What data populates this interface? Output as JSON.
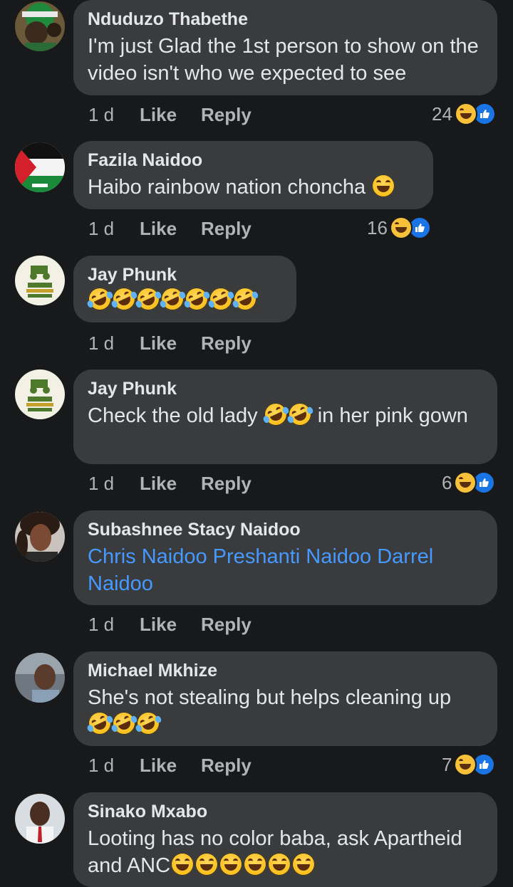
{
  "comments": [
    {
      "author": "Nduduzo Thabethe",
      "text": "I'm just Glad the 1st person to show on the video isn't who we expected to see",
      "age": "1 d",
      "like_label": "Like",
      "reply_label": "Reply",
      "reaction_count": "24",
      "reaction_icons": [
        "haha-icon",
        "like-icon"
      ],
      "avatar": "avatar-photo-green-hat"
    },
    {
      "author": "Fazila Naidoo",
      "text": "Haibo rainbow nation choncha",
      "emoji_count": 1,
      "age": "1 d",
      "like_label": "Like",
      "reply_label": "Reply",
      "reaction_count": "16",
      "reaction_icons": [
        "haha-icon",
        "like-icon"
      ],
      "avatar": "avatar-free-palestine-flag"
    },
    {
      "author": "Jay Phunk",
      "text": "",
      "emoji_count": 7,
      "age": "1 d",
      "like_label": "Like",
      "reply_label": "Reply",
      "avatar": "avatar-support-local-farmers"
    },
    {
      "author": "Jay Phunk",
      "text_before": "Check the old lady",
      "text_after": "in her pink gown",
      "emoji_count": 2,
      "age": "1 d",
      "like_label": "Like",
      "reply_label": "Reply",
      "reaction_count": "6",
      "reaction_icons": [
        "haha-icon",
        "like-icon"
      ],
      "avatar": "avatar-support-local-farmers"
    },
    {
      "author": "Subashnee Stacy Naidoo",
      "mentions": "Chris Naidoo Preshanti Naidoo Darrel Naidoo",
      "age": "1 d",
      "like_label": "Like",
      "reply_label": "Reply",
      "avatar": "avatar-photo-woman"
    },
    {
      "author": "Michael Mkhize",
      "text": "She's not stealing but helps cleaning up",
      "emoji_count": 3,
      "age": "1 d",
      "like_label": "Like",
      "reply_label": "Reply",
      "reaction_count": "7",
      "reaction_icons": [
        "haha-icon",
        "like-icon"
      ],
      "avatar": "avatar-photo-man-car"
    },
    {
      "author": "Sinako Mxabo",
      "text": "Looting has no color baba,  ask Apartheid and ANC",
      "emoji_count": 6,
      "avatar": "avatar-photo-man-red-tie"
    }
  ],
  "colors": {
    "background": "#18191a",
    "bubble": "#3a3b3c",
    "text": "#e4e6eb",
    "secondary_text": "#b0b3b8",
    "link": "#4599ff",
    "like_blue": "#1b74e4",
    "haha_yellow": "#f7c23a"
  }
}
